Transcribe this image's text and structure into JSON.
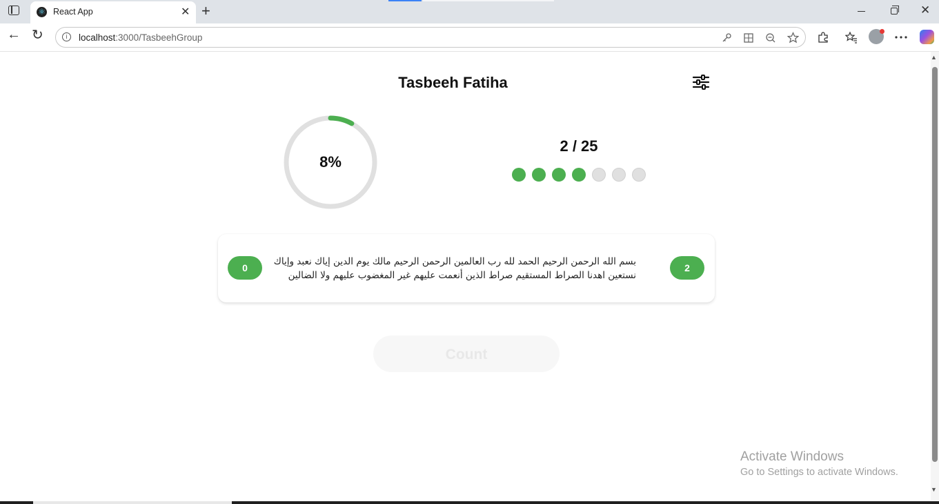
{
  "browser": {
    "tab_title": "React App",
    "tab_favicon": "react-icon",
    "url_host": "localhost",
    "url_path": ":3000/TasbeehGroup",
    "icons": {
      "sidebar_toggle": "sidebar-toggle-icon",
      "close_tab": "✕",
      "new_tab": "+",
      "back": "←",
      "reload": "↻",
      "minimize": "minimize-icon",
      "maximize": "restore-icon",
      "close_window": "✕"
    }
  },
  "page": {
    "title": "Tasbeeh Fatiha",
    "progress": {
      "fraction": 0.08,
      "label": "8%",
      "color": "#4caf50",
      "track_color": "#e0e0e0"
    },
    "count": {
      "text": "2 / 25",
      "dots_filled": 4,
      "dots_total": 7
    },
    "member": {
      "left_badge": "0",
      "right_badge": "2",
      "verse_line1": "بسم الله الرحمن الرحيم الحمد لله رب العالمين الرحمن الرحيم مالك يوم الدين إياك نعبد وإياك",
      "verse_line2": "نستعين اهدنا الصراط المستقيم صراط الذين أنعمت عليهم غير المغضوب عليهم ولا الضالين"
    },
    "count_button_label": "Count"
  },
  "watermark": {
    "title": "Activate Windows",
    "subtitle": "Go to Settings to activate Windows."
  },
  "colors": {
    "accent": "#4caf50"
  }
}
